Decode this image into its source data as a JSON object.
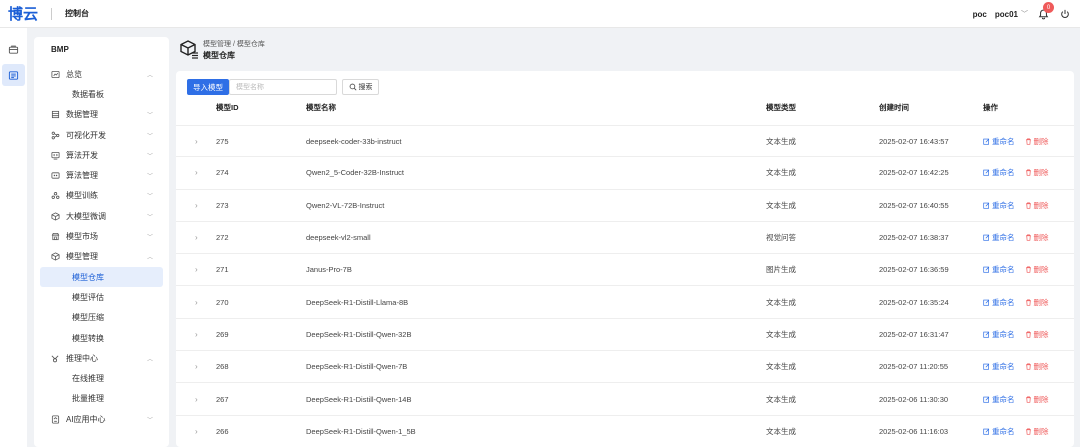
{
  "header": {
    "logo": "博云",
    "title": "控制台",
    "user": "poc",
    "account": "poc01",
    "notification_count": "0"
  },
  "sidebar": {
    "title": "BMP",
    "items": [
      {
        "type": "group",
        "label": "总览",
        "icon": "dashboard-icon",
        "arrow": "up"
      },
      {
        "type": "sub",
        "label": "数据看板"
      },
      {
        "type": "group",
        "label": "数据管理",
        "icon": "database-icon",
        "arrow": "down"
      },
      {
        "type": "group",
        "label": "可视化开发",
        "icon": "flow-icon",
        "arrow": "down"
      },
      {
        "type": "group",
        "label": "算法开发",
        "icon": "code-icon",
        "arrow": "down"
      },
      {
        "type": "group",
        "label": "算法管理",
        "icon": "algorithm-icon",
        "arrow": "down"
      },
      {
        "type": "group",
        "label": "模型训练",
        "icon": "training-icon",
        "arrow": "down"
      },
      {
        "type": "group",
        "label": "大模型微调",
        "icon": "cube-icon",
        "arrow": "down"
      },
      {
        "type": "group",
        "label": "模型市场",
        "icon": "market-icon",
        "arrow": "down"
      },
      {
        "type": "group",
        "label": "模型管理",
        "icon": "model-icon",
        "arrow": "up"
      },
      {
        "type": "sub",
        "label": "模型仓库",
        "active": true
      },
      {
        "type": "sub",
        "label": "模型评估"
      },
      {
        "type": "sub",
        "label": "模型压缩"
      },
      {
        "type": "sub",
        "label": "模型转换"
      },
      {
        "type": "group",
        "label": "推理中心",
        "icon": "inference-icon",
        "arrow": "up"
      },
      {
        "type": "sub",
        "label": "在线推理"
      },
      {
        "type": "sub",
        "label": "批量推理"
      },
      {
        "type": "group",
        "label": "AI应用中心",
        "icon": "app-icon",
        "arrow": "down"
      }
    ]
  },
  "main": {
    "breadcrumb": "模型管理 / 模型仓库",
    "page_title": "模型仓库",
    "import_button": "导入模型",
    "search_placeholder": "模型名称",
    "search_button": "搜索",
    "columns": {
      "id": "模型ID",
      "name": "模型名称",
      "type": "模型类型",
      "created": "创建时间",
      "actions": "操作"
    },
    "rename_label": "重命名",
    "delete_label": "删除",
    "rows": [
      {
        "id": "275",
        "name": "deepseek-coder-33b-instruct",
        "type": "文本生成",
        "created": "2025-02-07 16:43:57"
      },
      {
        "id": "274",
        "name": "Qwen2_5-Coder-32B-Instruct",
        "type": "文本生成",
        "created": "2025-02-07 16:42:25"
      },
      {
        "id": "273",
        "name": "Qwen2-VL-72B-Instruct",
        "type": "文本生成",
        "created": "2025-02-07 16:40:55"
      },
      {
        "id": "272",
        "name": "deepseek-vl2-small",
        "type": "视觉问答",
        "created": "2025-02-07 16:38:37"
      },
      {
        "id": "271",
        "name": "Janus-Pro-7B",
        "type": "图片生成",
        "created": "2025-02-07 16:36:59"
      },
      {
        "id": "270",
        "name": "DeepSeek-R1-Distill-Llama-8B",
        "type": "文本生成",
        "created": "2025-02-07 16:35:24"
      },
      {
        "id": "269",
        "name": "DeepSeek-R1-Distill-Qwen-32B",
        "type": "文本生成",
        "created": "2025-02-07 16:31:47"
      },
      {
        "id": "268",
        "name": "DeepSeek-R1-Distill-Qwen-7B",
        "type": "文本生成",
        "created": "2025-02-07 11:20:55"
      },
      {
        "id": "267",
        "name": "DeepSeek-R1-Distill-Qwen-14B",
        "type": "文本生成",
        "created": "2025-02-06 11:30:30"
      },
      {
        "id": "266",
        "name": "DeepSeek-R1-Distill-Qwen-1_5B",
        "type": "文本生成",
        "created": "2025-02-06 11:16:03"
      }
    ]
  },
  "colors": {
    "primary": "#2f6fe6",
    "danger": "#ef5a5a",
    "active_bg": "#e6eefc"
  }
}
